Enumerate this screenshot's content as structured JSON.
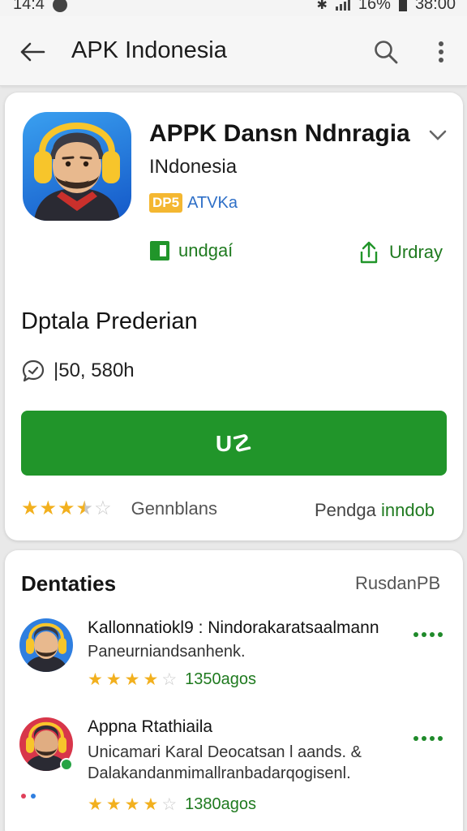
{
  "status_bar": {
    "time": "14:4",
    "battery": "16%",
    "clock": "38:00"
  },
  "app_bar": {
    "title": "APK Indonesia",
    "back_icon": "arrow-left-icon",
    "search_icon": "search-icon",
    "more_icon": "more-vert-icon"
  },
  "app": {
    "name": "APPK Dansn Ndnragia",
    "subtitle": "INdonesia",
    "badge": "DP5",
    "badge_link": "ATVKa",
    "action_left": "undgaí",
    "action_right": "Urdray",
    "section_title": "Dptala Prederian",
    "meta_value": "|50, 580h",
    "install_label": "U☡",
    "rating": 3.5,
    "rating_label": "Gennblans",
    "rating_right_prefix": "Pendga ",
    "rating_right_accent": "inndob"
  },
  "reviews": {
    "title": "Dentaties",
    "more_link": "RusdanPB",
    "items": [
      {
        "name": "Kallonnatiokl9 : Nindorakaratsaalmann",
        "text_lines": [
          "Paneurniandsanhenk."
        ],
        "rating": 4,
        "date": "1350agos"
      },
      {
        "name": "Appna Rtathiaila",
        "text_lines": [
          "Unicamari Karal Deocatsan l aands. &",
          "Dalakandanmimallranbadarqogisenl."
        ],
        "rating": 4,
        "date": "1380agos"
      }
    ]
  },
  "colors": {
    "accent_green": "#21952a",
    "star": "#f2b01e",
    "link_blue": "#2e6fc7",
    "badge_yellow": "#f4b731"
  }
}
